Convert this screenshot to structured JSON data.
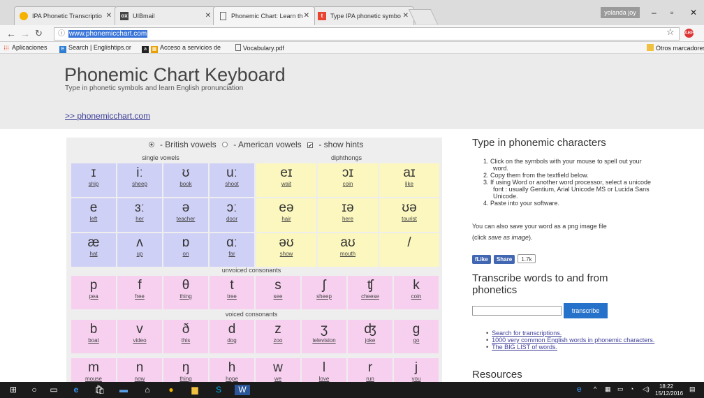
{
  "browser": {
    "tabs": [
      {
        "title": "IPA Phonetic Transcriptio",
        "icon": "smiley-icon",
        "color": "#f5b300"
      },
      {
        "title": "UIBmail",
        "icon": "mail-icon",
        "color": "#444444"
      },
      {
        "title": "Phonemic Chart: Learn th",
        "icon": "page-icon",
        "color": "#666666"
      },
      {
        "title": "Type IPA phonetic symbo",
        "icon": "t-icon",
        "color": "#e8442f"
      }
    ],
    "profile": "yolanda joy",
    "url": "www.phonemicchart.com",
    "bookmarks": [
      "Aplicaciones",
      "Search | Englishtips.or",
      "Acceso a servicios de",
      "Vocabulary.pdf"
    ],
    "other_bookmarks": "Otros marcadores"
  },
  "site": {
    "title": "Phonemic Chart Keyboard",
    "subtitle": "Type in phonetic symbols and learn English pronunciation",
    "link": ">> phonemicchart.com"
  },
  "options": {
    "british": " - British vowels ",
    "american": " - American vowels ",
    "hints": " - show hints"
  },
  "sections": {
    "single": "single vowels",
    "diph": "diphthongs",
    "unvoiced": "unvoiced consonants",
    "voiced": "voiced consonants"
  },
  "vowels": [
    [
      {
        "s": "ɪ",
        "w": "ship"
      },
      {
        "s": "iː",
        "w": "sheep"
      },
      {
        "s": "ʊ",
        "w": "book"
      },
      {
        "s": "uː",
        "w": "shoot"
      }
    ],
    [
      {
        "s": "e",
        "w": "left"
      },
      {
        "s": "ɜː",
        "w": "her"
      },
      {
        "s": "ə",
        "w": "teacher"
      },
      {
        "s": "ɔː",
        "w": "door"
      }
    ],
    [
      {
        "s": "æ",
        "w": "hat"
      },
      {
        "s": "ʌ",
        "w": "up"
      },
      {
        "s": "ɒ",
        "w": "on"
      },
      {
        "s": "ɑː",
        "w": "far"
      }
    ]
  ],
  "diphthongs": [
    [
      {
        "s": "eɪ",
        "w": "wait"
      },
      {
        "s": "ɔɪ",
        "w": "coin"
      },
      {
        "s": "aɪ",
        "w": "like"
      }
    ],
    [
      {
        "s": "eə",
        "w": "hair"
      },
      {
        "s": "ɪə",
        "w": "here"
      },
      {
        "s": "ʊə",
        "w": "tourist"
      }
    ],
    [
      {
        "s": "əʊ",
        "w": "show"
      },
      {
        "s": "aʊ",
        "w": "mouth"
      },
      {
        "s": "/",
        "w": ""
      }
    ]
  ],
  "unvoiced": [
    {
      "s": "p",
      "w": "pea"
    },
    {
      "s": "f",
      "w": "free"
    },
    {
      "s": "θ",
      "w": "thing"
    },
    {
      "s": "t",
      "w": "tree"
    },
    {
      "s": "s",
      "w": "see"
    },
    {
      "s": "ʃ",
      "w": "sheep"
    },
    {
      "s": "ʧ",
      "w": "cheese"
    },
    {
      "s": "k",
      "w": "coin"
    }
  ],
  "voiced": [
    {
      "s": "b",
      "w": "boat"
    },
    {
      "s": "v",
      "w": "video"
    },
    {
      "s": "ð",
      "w": "this"
    },
    {
      "s": "d",
      "w": "dog"
    },
    {
      "s": "z",
      "w": "zoo"
    },
    {
      "s": "ʒ",
      "w": "television"
    },
    {
      "s": "ʤ",
      "w": "joke"
    },
    {
      "s": "g",
      "w": "go"
    }
  ],
  "others": [
    {
      "s": "m",
      "w": "mouse"
    },
    {
      "s": "n",
      "w": "now"
    },
    {
      "s": "ŋ",
      "w": "thing"
    },
    {
      "s": "h",
      "w": "hope"
    },
    {
      "s": "w",
      "w": "we"
    },
    {
      "s": "l",
      "w": "love"
    },
    {
      "s": "r",
      "w": "run"
    },
    {
      "s": "j",
      "w": "you"
    }
  ],
  "sidebar": {
    "heading1": "Type in phonemic characters",
    "steps": [
      "1. Click on the symbols with your mouse to spell out your word.",
      "2. Copy them from the textfield below.",
      "3. If using Word or another word processor, select a unicode font : usually Gentium, Arial Unicode MS or Lucida Sans Unicode.",
      "4. Paste into your software."
    ],
    "save_note": "You can also save your word as a png image file",
    "save_hint_pre": "(click ",
    "save_hint_em": "save as image",
    "save_hint_post": ").",
    "like": "Like",
    "share": "Share",
    "share_count": "1.7k",
    "heading2": "Transcribe words to and from phonetics",
    "transcribe": "transcribe",
    "links": [
      "Search for transcriptions.",
      "1000 very common English words in phonemic characters.",
      "The BIG LIST of words."
    ],
    "heading3": "Resources"
  },
  "taskbar": {
    "time": "18:22",
    "date": "15/12/2016"
  }
}
